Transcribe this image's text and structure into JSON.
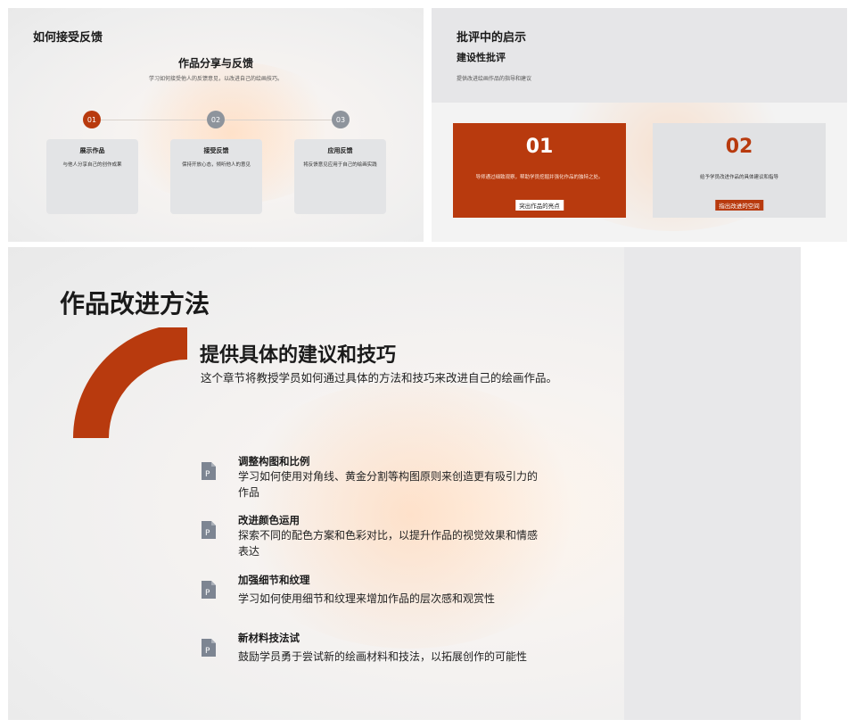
{
  "slide1": {
    "title": "如何接受反馈",
    "subtitle": "作品分享与反馈",
    "desc": "学习如何接受他人的反馈意见，以改进自己的绘画技巧。",
    "steps": [
      {
        "num": "01",
        "heading": "展示作品",
        "text": "与他人分享自己的创作成果"
      },
      {
        "num": "02",
        "heading": "接受反馈",
        "text": "保持开放心态，倾听他人的意见"
      },
      {
        "num": "03",
        "heading": "应用反馈",
        "text": "将反馈意见应用于自己的绘画实践"
      }
    ],
    "colors": {
      "accent": "#b83a0e",
      "muted": "#8e949c"
    }
  },
  "slide2": {
    "title": "批评中的启示",
    "subtitle": "建设性批评",
    "desc": "提供改进绘画作品的指导和建议",
    "cards": [
      {
        "num": "01",
        "text": "导师通过细致观察，帮助学员挖掘并强化作品的独特之处。",
        "tag": "突出作品的亮点"
      },
      {
        "num": "02",
        "text": "给予学员改进作品的具体建议和指导",
        "tag": "指出改进的空间"
      }
    ]
  },
  "slide3": {
    "title": "作品改进方法",
    "subtitle": "提供具体的建议和技巧",
    "lead": "这个章节将教授学员如何通过具体的方法和技巧来改进自己的绘画作品。",
    "items": [
      {
        "heading": "调整构图和比例",
        "text": "学习如何使用对角线、黄金分割等构图原则来创造更有吸引力的作品",
        "icon": "document-icon"
      },
      {
        "heading": "改进颜色运用",
        "text": "探索不同的配色方案和色彩对比，以提升作品的视觉效果和情感表达",
        "icon": "document-icon"
      },
      {
        "heading": "加强细节和纹理",
        "text": "学习如何使用细节和纹理来增加作品的层次感和观赏性",
        "icon": "document-icon"
      },
      {
        "heading": "新材料技法试",
        "text": "鼓励学员勇于尝试新的绘画材料和技法，以拓展创作的可能性",
        "icon": "document-icon"
      }
    ]
  }
}
